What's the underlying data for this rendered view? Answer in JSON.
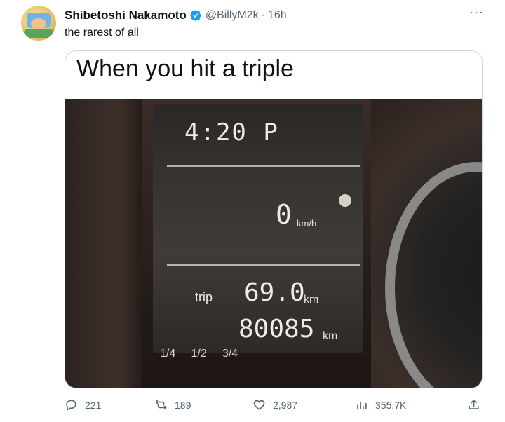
{
  "tweet": {
    "author_name": "Shibetoshi Nakamoto",
    "handle": "@BillyM2k",
    "separator": "·",
    "time": "16h",
    "more_label": "···",
    "text": "the rarest of all",
    "image_caption": "When you hit a triple",
    "dashboard": {
      "clock": "4:20 P",
      "speed": "0",
      "speed_unit": "km/h",
      "trip_label": "trip",
      "trip_value": "69.0",
      "trip_unit": "km",
      "odometer": "80085",
      "odometer_unit": "km",
      "gauge_marks": "1/4     1/2     3/4"
    },
    "actions": {
      "replies": "221",
      "reposts": "189",
      "likes": "2,987",
      "views": "355.7K"
    }
  },
  "colors": {
    "verified": "#1d9bf0",
    "text_primary": "#0f1419",
    "text_secondary": "#536471",
    "border": "#cfd9de"
  }
}
